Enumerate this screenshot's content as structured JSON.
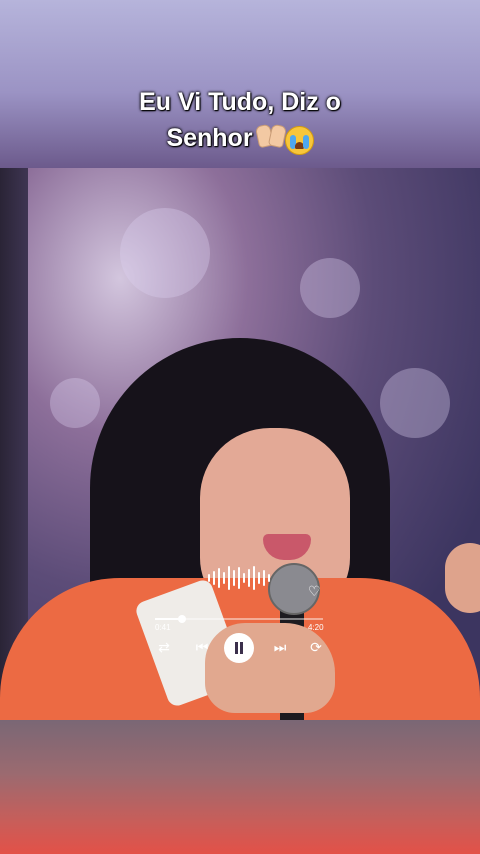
{
  "caption": {
    "line1": "Eu Vi Tudo, Diz o",
    "line2": "Senhor"
  },
  "player": {
    "current_time": "0:41",
    "total_time": "4:20",
    "progress": 0.16,
    "icons": [
      "waveform-icon",
      "heart-icon",
      "shuffle-icon",
      "previous-icon",
      "pause-icon",
      "next-icon",
      "repeat-icon"
    ]
  },
  "colors": {
    "jacket": "#ec6a43",
    "player_accent": "#ffffff"
  }
}
